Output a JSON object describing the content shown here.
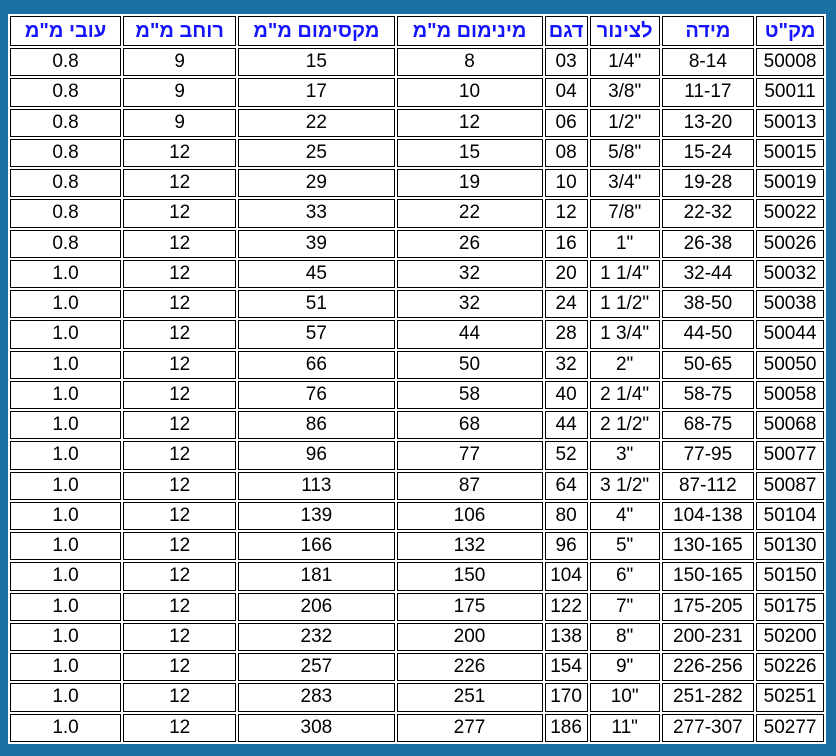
{
  "table": {
    "headers": [
      "מק\"ט",
      "מידה",
      "לצינור",
      "דגם",
      "מינימום מ\"מ",
      "מקסימום מ\"מ",
      "רוחב מ\"מ",
      "עובי מ\"מ"
    ],
    "rows": [
      [
        "50008",
        "8-14",
        "1/4\"",
        "03",
        "8",
        "15",
        "9",
        "0.8"
      ],
      [
        "50011",
        "11-17",
        "3/8\"",
        "04",
        "10",
        "17",
        "9",
        "0.8"
      ],
      [
        "50013",
        "13-20",
        "1/2\"",
        "06",
        "12",
        "22",
        "9",
        "0.8"
      ],
      [
        "50015",
        "15-24",
        "5/8\"",
        "08",
        "15",
        "25",
        "12",
        "0.8"
      ],
      [
        "50019",
        "19-28",
        "3/4\"",
        "10",
        "19",
        "29",
        "12",
        "0.8"
      ],
      [
        "50022",
        "22-32",
        "7/8\"",
        "12",
        "22",
        "33",
        "12",
        "0.8"
      ],
      [
        "50026",
        "26-38",
        "1\"",
        "16",
        "26",
        "39",
        "12",
        "0.8"
      ],
      [
        "50032",
        "32-44",
        "1 1/4\"",
        "20",
        "32",
        "45",
        "12",
        "1.0"
      ],
      [
        "50038",
        "38-50",
        "1 1/2\"",
        "24",
        "32",
        "51",
        "12",
        "1.0"
      ],
      [
        "50044",
        "44-50",
        "1 3/4\"",
        "28",
        "44",
        "57",
        "12",
        "1.0"
      ],
      [
        "50050",
        "50-65",
        "2\"",
        "32",
        "50",
        "66",
        "12",
        "1.0"
      ],
      [
        "50058",
        "58-75",
        "2 1/4\"",
        "40",
        "58",
        "76",
        "12",
        "1.0"
      ],
      [
        "50068",
        "68-75",
        "2 1/2\"",
        "44",
        "68",
        "86",
        "12",
        "1.0"
      ],
      [
        "50077",
        "77-95",
        "3\"",
        "52",
        "77",
        "96",
        "12",
        "1.0"
      ],
      [
        "50087",
        "87-112",
        "3 1/2\"",
        "64",
        "87",
        "113",
        "12",
        "1.0"
      ],
      [
        "50104",
        "104-138",
        "4\"",
        "80",
        "106",
        "139",
        "12",
        "1.0"
      ],
      [
        "50130",
        "130-165",
        "5\"",
        "96",
        "132",
        "166",
        "12",
        "1.0"
      ],
      [
        "50150",
        "150-165",
        "6\"",
        "104",
        "150",
        "181",
        "12",
        "1.0"
      ],
      [
        "50175",
        "175-205",
        "7\"",
        "122",
        "175",
        "206",
        "12",
        "1.0"
      ],
      [
        "50200",
        "200-231",
        "8\"",
        "138",
        "200",
        "232",
        "12",
        "1.0"
      ],
      [
        "50226",
        "226-256",
        "9\"",
        "154",
        "226",
        "257",
        "12",
        "1.0"
      ],
      [
        "50251",
        "251-282",
        "10\"",
        "170",
        "251",
        "283",
        "12",
        "1.0"
      ],
      [
        "50277",
        "277-307",
        "11\"",
        "186",
        "277",
        "308",
        "12",
        "1.0"
      ]
    ]
  }
}
